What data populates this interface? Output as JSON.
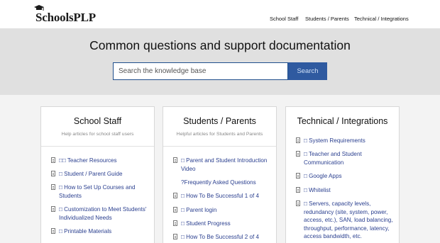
{
  "header": {
    "logo_text_a": "Schools",
    "logo_text_b": "PLP",
    "nav": [
      "School Staff",
      "Students / Parents",
      "Technical / Integrations"
    ]
  },
  "hero": {
    "title": "Common questions and support documentation",
    "search_placeholder": "Search the knowledge base",
    "search_button": "Search"
  },
  "cards": [
    {
      "title": "School Staff",
      "subtitle": "Help articles for school staff users",
      "items": [
        "□□ Teacher Resources",
        "□ Student / Parent Guide",
        "□ How to Set Up Courses and Students",
        "□ Customization to Meet Students' Individualized Needs",
        "□ Printable Materials"
      ]
    },
    {
      "title": "Students / Parents",
      "subtitle": "Helpful articles for Students and Parents",
      "items": [
        "□ Parent and Student Introduction Video",
        "?Frequently Asked Questions",
        "□ How To Be Successful 1 of 4",
        "□ Parent login",
        "□ Student Progress",
        "□ How To Be Successful 2 of 4"
      ]
    },
    {
      "title": "Technical / Integrations",
      "subtitle": "",
      "items": [
        "□ System Requirements",
        "□ Teacher and Student Communication",
        "□ Google Apps",
        "□ Whitelist",
        "□ Servers, capacity levels, redundancy (site, system, power, access, etc.), SAN, load balancing, throughput, performance, latency, access bandwidth, etc."
      ]
    }
  ],
  "colors": {
    "link": "#2a3f8f",
    "search_button": "#2f5aa0",
    "hero_bg": "#e0e0e0"
  }
}
